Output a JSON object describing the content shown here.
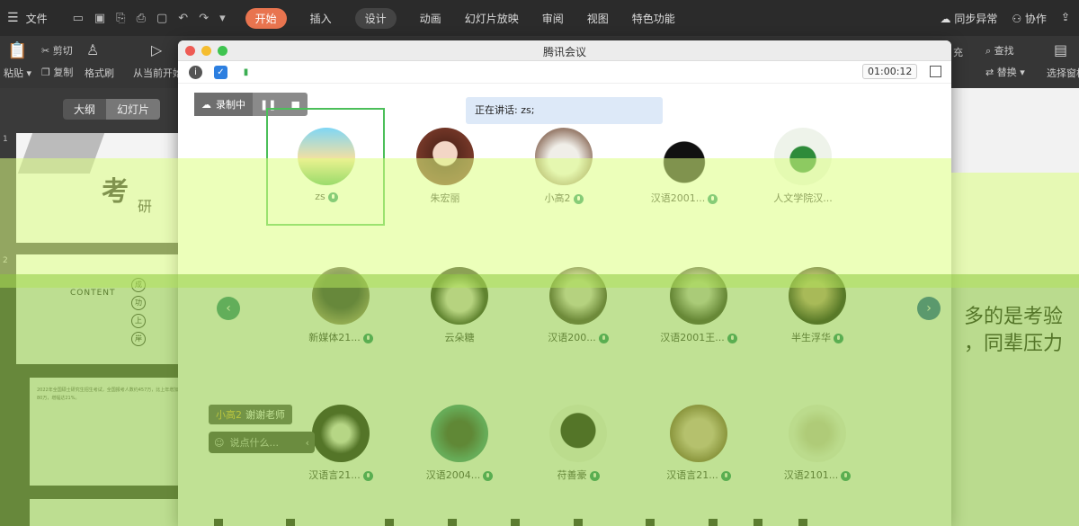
{
  "menubar": {
    "file": "文件",
    "tabs": [
      "开始",
      "插入",
      "设计",
      "动画",
      "幻灯片放映",
      "审阅",
      "视图",
      "特色功能"
    ],
    "sync": "同步异常",
    "collab": "协作"
  },
  "ribbon": {
    "paste": "粘贴",
    "cut": "剪切",
    "copy": "复制",
    "format_painter": "格式刷",
    "play_from_current": "从当前开始",
    "find": "查找",
    "replace": "替换",
    "select_pane": "选择窗格",
    "partial": "充"
  },
  "left_panel": {
    "outline": "大纲",
    "slides": "幻灯片",
    "slide1_num": "1",
    "slide2_num": "2",
    "slide1_kao": "考",
    "slide1_yan": "研",
    "slide2_content": "CONTENT",
    "slide2_circles": [
      "成",
      "功",
      "上",
      "岸"
    ],
    "slide3_text": "2022年全国硕士研究生招生考试，全国报考人数约457万，比上年增加了80万，增幅达21%。"
  },
  "slide_text": {
    "line1": "多的是考验",
    "line2": "，同辈压力"
  },
  "meeting": {
    "title": "腾讯会议",
    "timer": "01:00:12",
    "recording": "录制中",
    "speaking": "正在讲话: zs;",
    "participants_row1": [
      "zs",
      "朱宏丽",
      "小高2",
      "汉语2001...",
      "人文学院汉..."
    ],
    "participants_row2": [
      "新媒体21...",
      "云朵糖",
      "汉语200...",
      "汉语2001王...",
      "半生浮华"
    ],
    "participants_row3": [
      "汉语言21...",
      "汉语2004...",
      "苻善豪",
      "汉语言21...",
      "汉语2101..."
    ],
    "chat_sender": "小高2",
    "chat_message": "谢谢老师",
    "chat_placeholder": "说点什么..."
  },
  "colors": {
    "active_tab": "#e8744f",
    "mic_green": "#1d8f6c",
    "speaker_border": "#4cbf5a",
    "nav_left": "#2f8f7f",
    "nav_right": "#1f5fa8"
  }
}
